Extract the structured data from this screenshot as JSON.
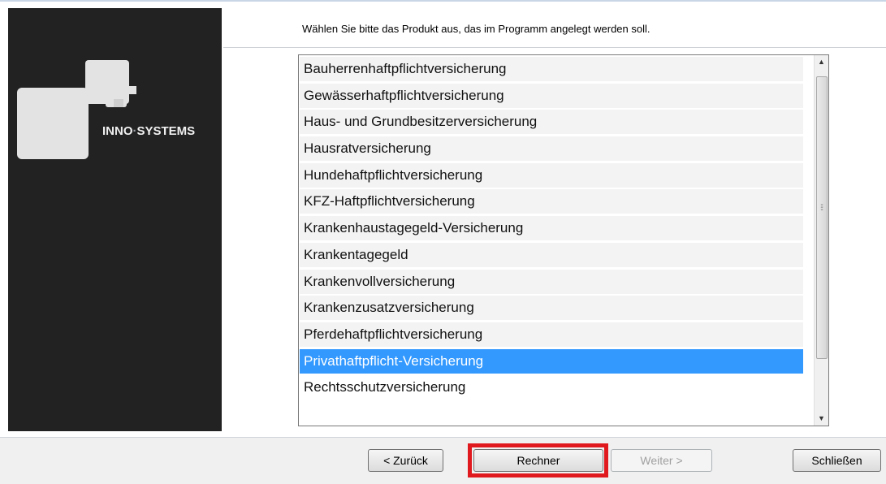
{
  "brand": {
    "left": "INNO",
    "separator": "·",
    "right": "SYSTEMS"
  },
  "header": {
    "instruction": "Wählen Sie bitte das Produkt aus, das im Programm angelegt werden soll."
  },
  "product_list": {
    "items": [
      "Bauherrenhaftpflichtversicherung",
      "Gewässerhaftpflichtversicherung",
      "Haus- und Grundbesitzerversicherung",
      "Hausratversicherung",
      "Hundehaftpflichtversicherung",
      "KFZ-Haftpflichtversicherung",
      "Krankenhaustagegeld-Versicherung",
      "Krankentagegeld",
      "Krankenvollversicherung",
      "Krankenzusatzversicherung",
      "Pferdehaftpflichtversicherung",
      "Privathaftpflicht-Versicherung",
      "Rechtsschutzversicherung"
    ],
    "selected": "Privathaftpflicht-Versicherung"
  },
  "buttons": {
    "back": "< Zurück",
    "calculator": "Rechner",
    "next": "Weiter >",
    "close": "Schließen"
  },
  "colors": {
    "selection": "#3399ff",
    "highlight": "#e0191e",
    "sidebar": "#222222"
  }
}
